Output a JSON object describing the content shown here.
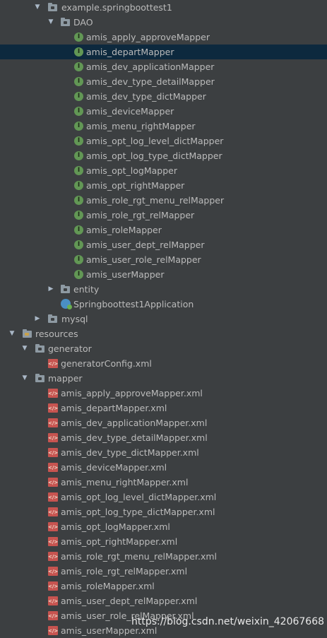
{
  "tree": {
    "package": "example.springboottest1",
    "dao_folder": "DAO",
    "dao_items": [
      "amis_apply_approveMapper",
      "amis_departMapper",
      "amis_dev_applicationMapper",
      "amis_dev_type_detailMapper",
      "amis_dev_type_dictMapper",
      "amis_deviceMapper",
      "amis_menu_rightMapper",
      "amis_opt_log_level_dictMapper",
      "amis_opt_log_type_dictMapper",
      "amis_opt_logMapper",
      "amis_opt_rightMapper",
      "amis_role_rgt_menu_relMapper",
      "amis_role_rgt_relMapper",
      "amis_roleMapper",
      "amis_user_dept_relMapper",
      "amis_user_role_relMapper",
      "amis_userMapper"
    ],
    "entity_folder": "entity",
    "app_class": "Springboottest1Application",
    "mysql_folder": "mysql",
    "resources_folder": "resources",
    "generator_folder": "generator",
    "generator_file": "generatorConfig.xml",
    "mapper_folder": "mapper",
    "mapper_items": [
      "amis_apply_approveMapper.xml",
      "amis_departMapper.xml",
      "amis_dev_applicationMapper.xml",
      "amis_dev_type_detailMapper.xml",
      "amis_dev_type_dictMapper.xml",
      "amis_deviceMapper.xml",
      "amis_menu_rightMapper.xml",
      "amis_opt_log_level_dictMapper.xml",
      "amis_opt_log_type_dictMapper.xml",
      "amis_opt_logMapper.xml",
      "amis_opt_rightMapper.xml",
      "amis_role_rgt_menu_relMapper.xml",
      "amis_role_rgt_relMapper.xml",
      "amis_roleMapper.xml",
      "amis_user_dept_relMapper.xml",
      "amis_user_role_relMapper.xml",
      "amis_userMapper.xml"
    ],
    "selected_item": "amis_departMapper"
  },
  "icons": {
    "expanded": "chevron-down-icon",
    "collapsed": "chevron-right-icon",
    "folder": "folder-icon",
    "interface": "interface-icon",
    "xml": "xml-file-icon",
    "app": "spring-boot-class-icon"
  },
  "colors": {
    "background": "#3c3f41",
    "selection": "#0d293e",
    "text": "#bbbbbb",
    "interface_icon": "#629755",
    "xml_icon": "#c75450"
  },
  "watermark": "https://blog.csdn.net/weixin_42067668"
}
